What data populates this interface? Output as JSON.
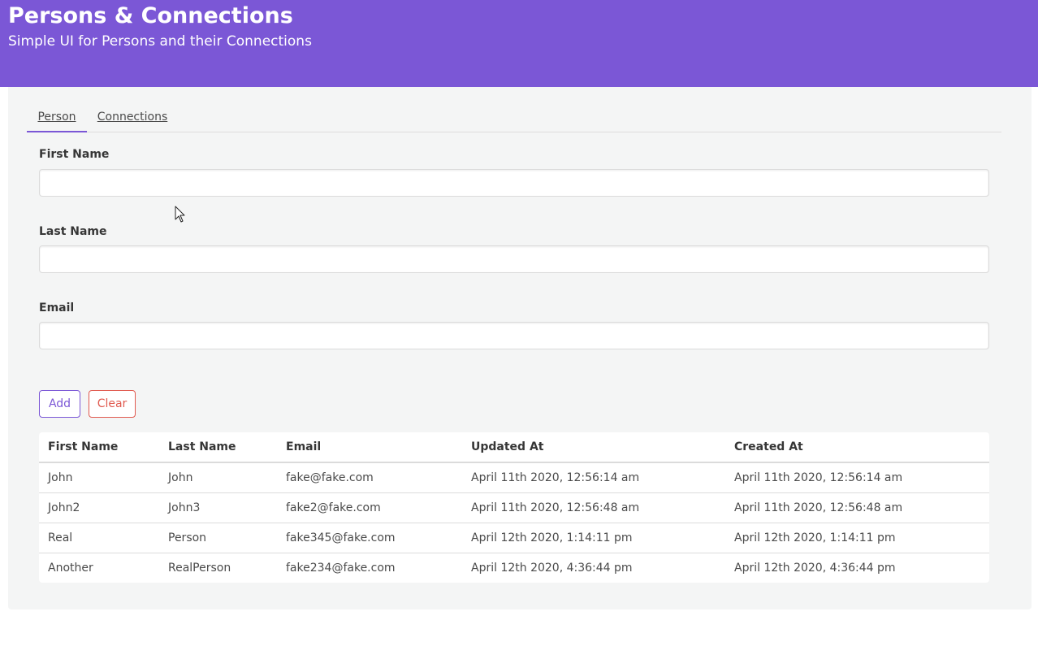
{
  "header": {
    "title": "Persons & Connections",
    "subtitle": "Simple UI for Persons and their Connections"
  },
  "tabs": [
    {
      "label": "Person",
      "active": true
    },
    {
      "label": "Connections",
      "active": false
    }
  ],
  "form": {
    "first_name": {
      "label": "First Name",
      "value": "",
      "placeholder": ""
    },
    "last_name": {
      "label": "Last Name",
      "value": "",
      "placeholder": ""
    },
    "email": {
      "label": "Email",
      "value": "",
      "placeholder": ""
    }
  },
  "buttons": {
    "add": "Add",
    "clear": "Clear"
  },
  "table": {
    "columns": [
      "First Name",
      "Last Name",
      "Email",
      "Updated At",
      "Created At"
    ],
    "rows": [
      [
        "John",
        "John",
        "fake@fake.com",
        "April 11th 2020, 12:56:14 am",
        "April 11th 2020, 12:56:14 am"
      ],
      [
        "John2",
        "John3",
        "fake2@fake.com",
        "April 11th 2020, 12:56:48 am",
        "April 11th 2020, 12:56:48 am"
      ],
      [
        "Real",
        "Person",
        "fake345@fake.com",
        "April 12th 2020, 1:14:11 pm",
        "April 12th 2020, 1:14:11 pm"
      ],
      [
        "Another",
        "RealPerson",
        "fake234@fake.com",
        "April 12th 2020, 4:36:44 pm",
        "April 12th 2020, 4:36:44 pm"
      ]
    ]
  },
  "colors": {
    "brand": "#7b57d6",
    "danger": "#e05a4f",
    "card_bg": "#f4f5f5"
  },
  "icons": {
    "cursor": "mouse-pointer-icon"
  }
}
